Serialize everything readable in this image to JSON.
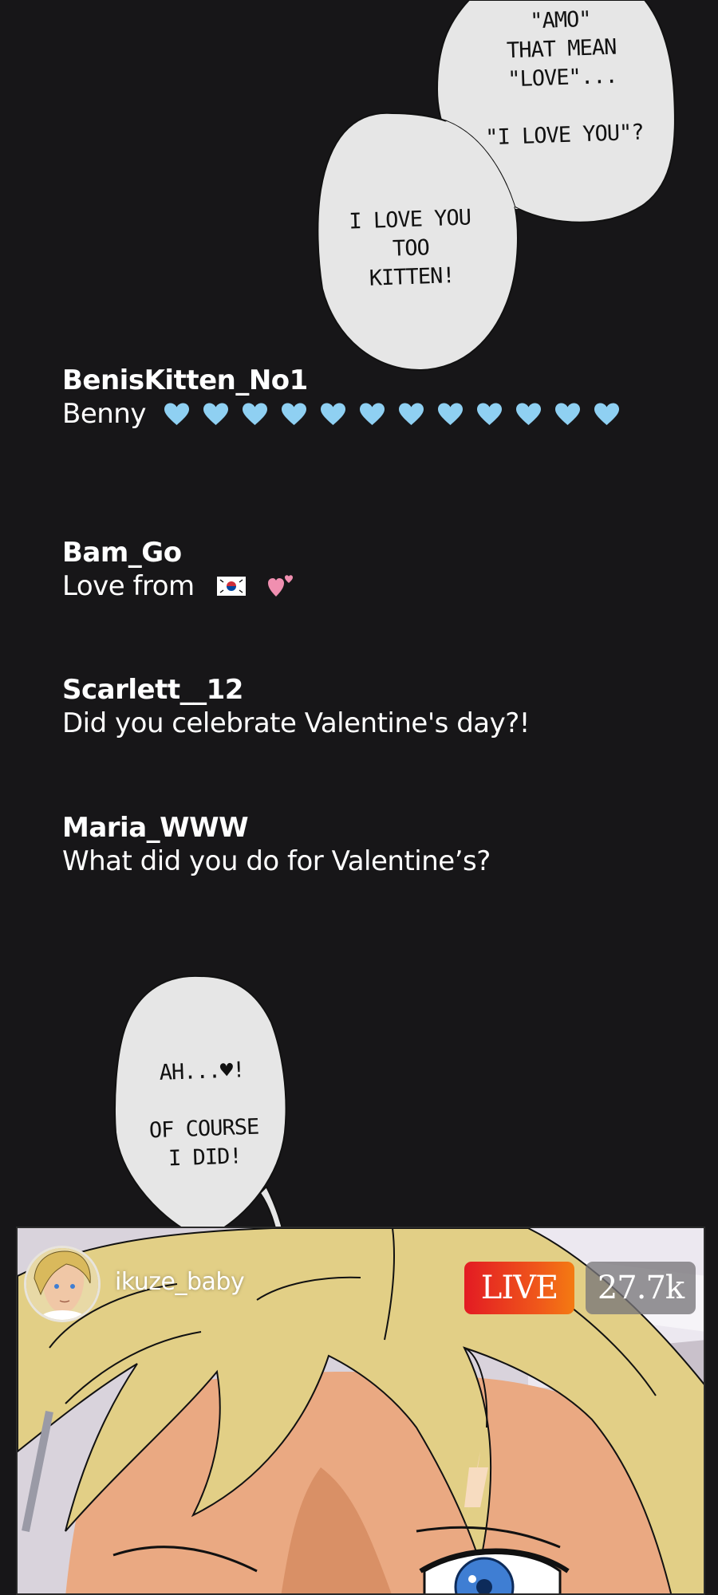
{
  "bubbles": {
    "top": "\"AMO\"\nTHAT MEAN\n\"LOVE\"...\n\n\"I LOVE YOU\"?",
    "middle": "I LOVE YOU\nTOO\nKITTEN!",
    "bottom": "AH...♥!\n\nOF COURSE\nI DID!"
  },
  "comments": [
    {
      "user": "BenisKitten_No1",
      "text": "Benny",
      "emoji": "blue-heart",
      "emoji_count": 12,
      "emoji_color": "#8fd0f2"
    },
    {
      "user": "Bam_Go",
      "text": "Love from",
      "emoji": [
        "south-korea-flag",
        "pink-two-hearts"
      ]
    },
    {
      "user": "Scarlett__12",
      "text": "Did you celebrate Valentine's day?!"
    },
    {
      "user": "Maria_WWW",
      "text": "What did you do for Valentine’s?"
    }
  ],
  "stream": {
    "streamer_name": "ikuze_baby",
    "live_label": "LIVE",
    "viewer_count": "27.7k",
    "live_badge_colors": [
      "#e31b23",
      "#f47b12"
    ]
  },
  "colors": {
    "background": "#171618",
    "bubble_fill": "#e6e6e6",
    "hair": "#e2cf86",
    "skin": "#eaa982",
    "eye": "#3f7ed3"
  }
}
